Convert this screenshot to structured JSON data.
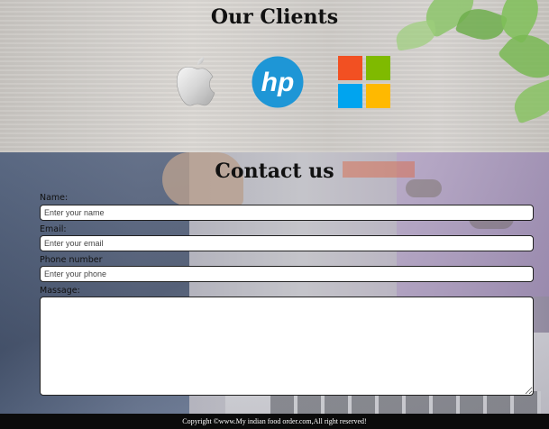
{
  "clients": {
    "title": "Our Clients",
    "logos": [
      "apple-logo",
      "hp-logo",
      "microsoft-logo"
    ],
    "hp_text": "hp",
    "colors": {
      "hp_blue": "#1e96d6",
      "ms_red": "#f25022",
      "ms_green": "#7fba00",
      "ms_blue": "#00a4ef",
      "ms_yellow": "#ffb900"
    }
  },
  "contact": {
    "title": "Contact us",
    "name": {
      "label": "Name:",
      "placeholder": "Enter your name",
      "value": ""
    },
    "email": {
      "label": "Email:",
      "placeholder": "Enter your email",
      "value": ""
    },
    "phone": {
      "label": "Phone number",
      "placeholder": "Enter your phone",
      "value": ""
    },
    "message": {
      "label": "Massage:",
      "value": ""
    }
  },
  "footer": {
    "copyright": "Copyright ©www.My indian food order.com,All right reserved!"
  }
}
